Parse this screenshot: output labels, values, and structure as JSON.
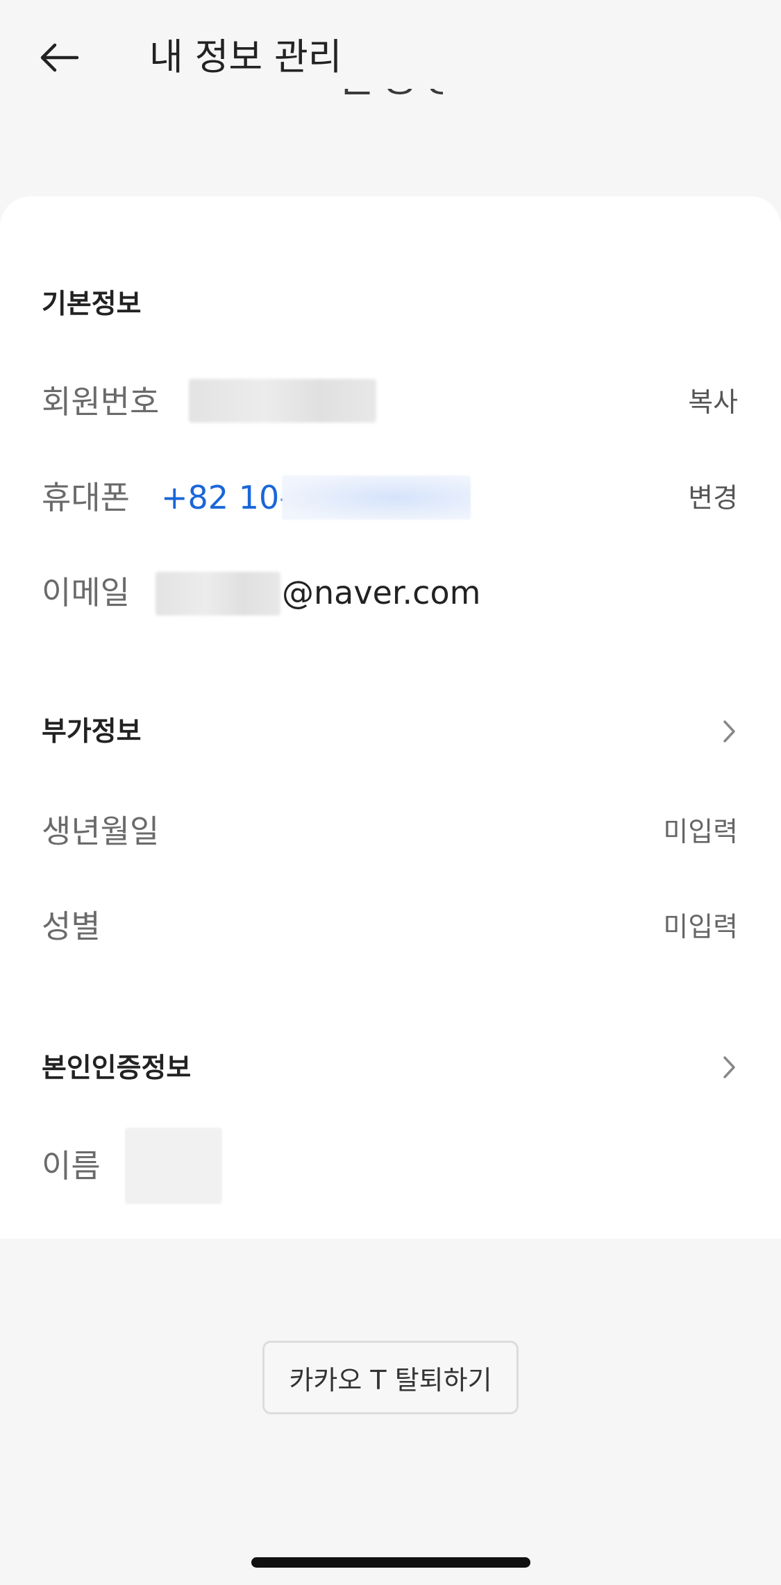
{
  "header": {
    "title": "내 정보 관리",
    "peek_text": "ᄃᄋᄋ"
  },
  "basic_info": {
    "section_title": "기본정보",
    "member_number": {
      "label": "회원번호",
      "action": "복사"
    },
    "phone": {
      "label": "휴대폰",
      "value_prefix": "+82 10-",
      "action": "변경"
    },
    "email": {
      "label": "이메일",
      "value_suffix": "@naver.com"
    }
  },
  "additional_info": {
    "section_title": "부가정보",
    "birthdate": {
      "label": "생년월일",
      "value": "미입력"
    },
    "gender": {
      "label": "성별",
      "value": "미입력"
    }
  },
  "verification_info": {
    "section_title": "본인인증정보",
    "name": {
      "label": "이름"
    }
  },
  "withdraw_button": "카카오 T 탈퇴하기",
  "colors": {
    "accent_blue": "#1a66d9",
    "background": "#f6f6f6",
    "card": "#ffffff"
  },
  "icons": {
    "back": "back-arrow-icon",
    "chevron": "chevron-right-icon"
  }
}
